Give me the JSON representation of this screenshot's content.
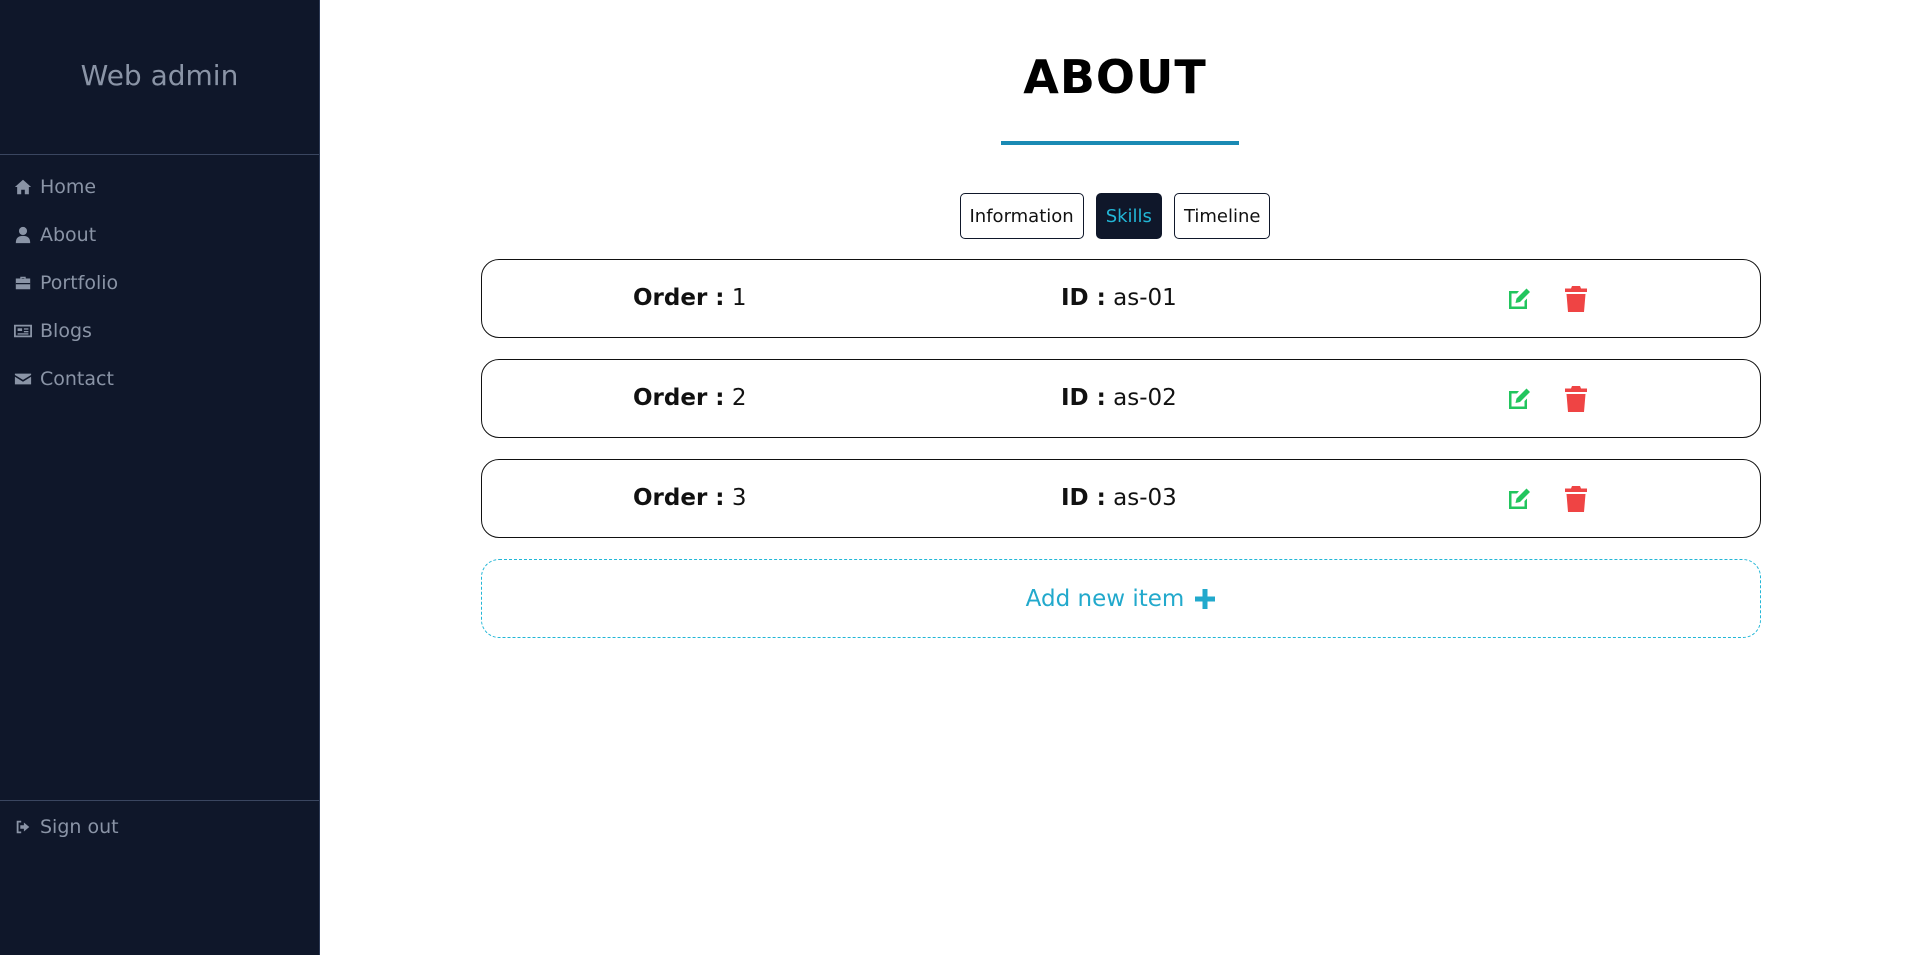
{
  "sidebar": {
    "brand": "Web admin",
    "items": [
      {
        "label": "Home",
        "icon": "home-icon"
      },
      {
        "label": "About",
        "icon": "user-icon"
      },
      {
        "label": "Portfolio",
        "icon": "briefcase-icon"
      },
      {
        "label": "Blogs",
        "icon": "newspaper-icon"
      },
      {
        "label": "Contact",
        "icon": "envelope-icon"
      }
    ],
    "signout": {
      "label": "Sign out",
      "icon": "sign-out-icon"
    }
  },
  "main": {
    "title": "ABOUT",
    "tabs": [
      {
        "label": "Information",
        "active": false
      },
      {
        "label": "Skills",
        "active": true
      },
      {
        "label": "Timeline",
        "active": false
      }
    ],
    "rows": [
      {
        "order_label": "Order :",
        "order": "1",
        "id_label": "ID :",
        "id": "as-01"
      },
      {
        "order_label": "Order :",
        "order": "2",
        "id_label": "ID :",
        "id": "as-02"
      },
      {
        "order_label": "Order :",
        "order": "3",
        "id_label": "ID :",
        "id": "as-03"
      }
    ],
    "add_item": {
      "label": "Add new item",
      "icon": "plus-icon"
    }
  },
  "colors": {
    "sidebar_bg": "#0f172a",
    "accent": "#22b6d6",
    "underline": "#1a8ab4",
    "edit": "#22c55e",
    "delete": "#ef4444"
  }
}
